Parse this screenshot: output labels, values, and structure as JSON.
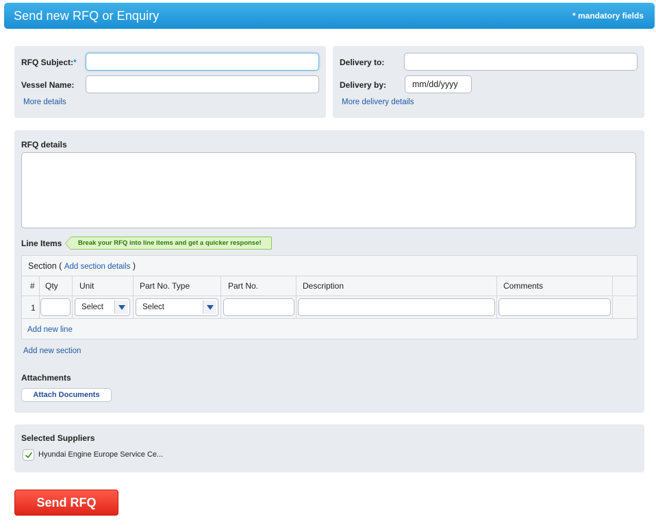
{
  "header": {
    "title": "Send new RFQ or Enquiry",
    "mandatory_note": "* mandatory fields"
  },
  "rfq_form": {
    "subject_label": "RFQ Subject:",
    "subject_required": "*",
    "subject_value": "",
    "vessel_label": "Vessel Name:",
    "vessel_value": "",
    "more_details": "More details"
  },
  "delivery": {
    "to_label": "Delivery to:",
    "to_value": "",
    "by_label": "Delivery by:",
    "by_placeholder": "mm/dd/yyyy",
    "more_details": "More delivery details"
  },
  "rfq_details": {
    "label": "RFQ details",
    "value": ""
  },
  "line_items": {
    "label": "Line Items",
    "hint": "Break your RFQ into line items and get a quicker response!",
    "section_label": "Section",
    "section_link": "Add section details",
    "columns": [
      "#",
      "Qty",
      "Unit",
      "Part No. Type",
      "Part No.",
      "Description",
      "Comments"
    ],
    "rows": [
      {
        "num": "1",
        "qty": "",
        "unit": "Select",
        "part_type": "Select",
        "part_no": "",
        "description": "",
        "comments": ""
      }
    ],
    "add_line": "Add new line",
    "add_section": "Add new section"
  },
  "attachments": {
    "label": "Attachments",
    "button": "Attach Documents"
  },
  "suppliers": {
    "label": "Selected Suppliers",
    "items": [
      {
        "name": "Hyundai Engine Europe Service Ce...",
        "checked": true
      }
    ]
  },
  "submit": {
    "label": "Send RFQ"
  },
  "colors": {
    "header": "#1a8fd4",
    "link": "#1f5aa6",
    "panel": "#e8ebef",
    "send_button": "#e0261a"
  }
}
